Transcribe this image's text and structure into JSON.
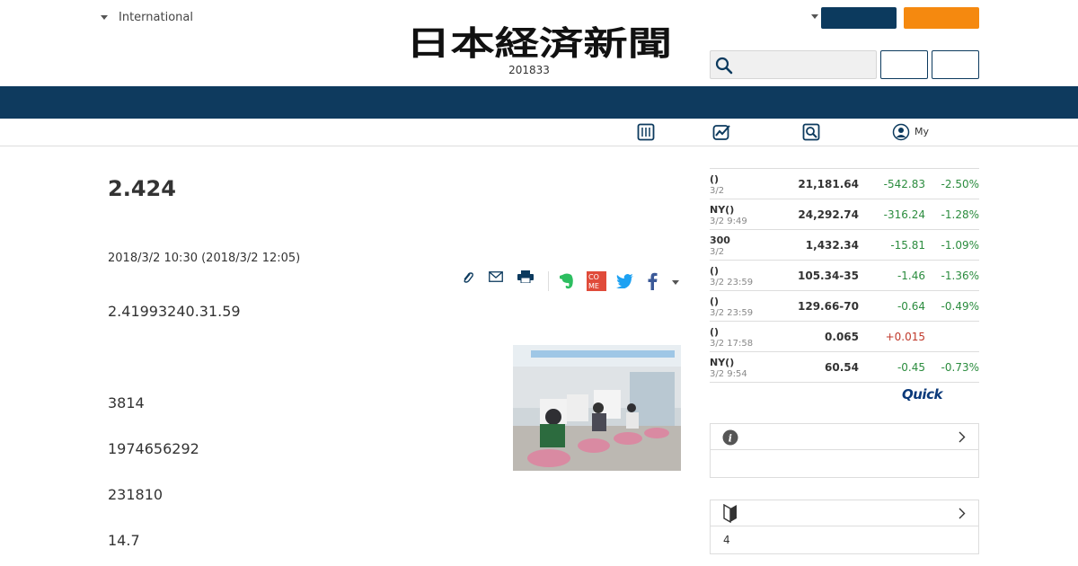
{
  "header": {
    "region_label": "International",
    "logo_alt": "日本経済新聞",
    "date": "201833"
  },
  "subnav": {
    "my_label": "My"
  },
  "article": {
    "title": "2.424",
    "published": "2018/3/2 10:30 (2018/3/2 12:05)",
    "paragraphs": [
      "2.41993240.31.59",
      "3814",
      "1974656292",
      "231810",
      "14.7"
    ]
  },
  "markets": [
    {
      "name": "()",
      "time": "3/2",
      "value": "21,181.64",
      "change": "-542.83",
      "percent": "-2.50%",
      "dir": "down"
    },
    {
      "name": "NY()",
      "time": "3/2 9:49",
      "value": "24,292.74",
      "change": "-316.24",
      "percent": "-1.28%",
      "dir": "down"
    },
    {
      "name": "300",
      "time": "3/2",
      "value": "1,432.34",
      "change": "-15.81",
      "percent": "-1.09%",
      "dir": "down"
    },
    {
      "name": "()",
      "time": "3/2 23:59",
      "value": "105.34-35",
      "change": "-1.46",
      "percent": "-1.36%",
      "dir": "down"
    },
    {
      "name": "()",
      "time": "3/2 23:59",
      "value": "129.66-70",
      "change": "-0.64",
      "percent": "-0.49%",
      "dir": "down"
    },
    {
      "name": "()",
      "time": "3/2 17:58",
      "value": "0.065",
      "change": "+0.015",
      "percent": "",
      "dir": "up"
    },
    {
      "name": "NY()",
      "time": "3/2 9:54",
      "value": "60.54",
      "change": "-0.45",
      "percent": "-0.73%",
      "dir": "down"
    }
  ],
  "quick_logo": "Quick",
  "info_box": {
    "body": ""
  },
  "beginner_box": {
    "body": "4"
  },
  "colors": {
    "navy": "#0c3a5e",
    "orange": "#f5890f",
    "down": "#2b8c3e",
    "up": "#c0392b"
  }
}
